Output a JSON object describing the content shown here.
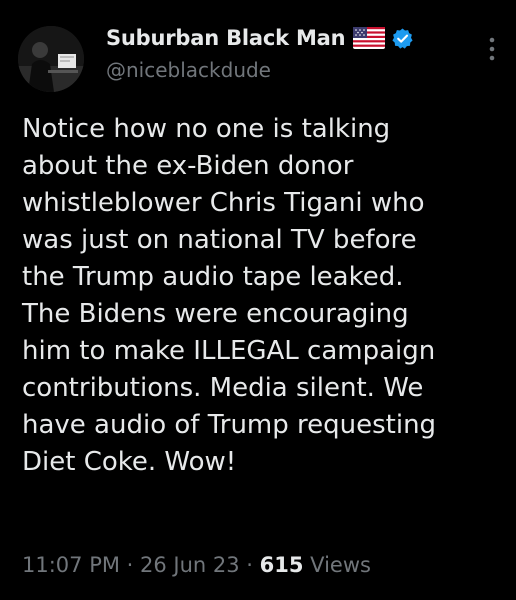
{
  "author": {
    "display_name": "Suburban Black Man",
    "handle": "@niceblackdude",
    "flag_icon": "us-flag-icon",
    "verified_icon": "verified-badge-icon",
    "verified_color": "#1d9bf0"
  },
  "menu": {
    "icon": "more-vertical-icon"
  },
  "tweet": {
    "text": "Notice how no one is talking\nabout the ex-Biden donor\nwhistleblower Chris Tigani who\nwas just on national TV before\nthe Trump audio tape leaked.\nThe Bidens were encouraging\nhim to make ILLEGAL campaign\ncontributions. Media silent. We\nhave audio of Trump requesting\nDiet Coke. Wow!"
  },
  "meta": {
    "time": "11:07 PM",
    "separator": " · ",
    "date": "26 Jun 23",
    "views_count": "615",
    "views_label": " Views"
  },
  "colors": {
    "background": "#000000",
    "primary_text": "#e7e9ea",
    "secondary_text": "#71767b"
  }
}
